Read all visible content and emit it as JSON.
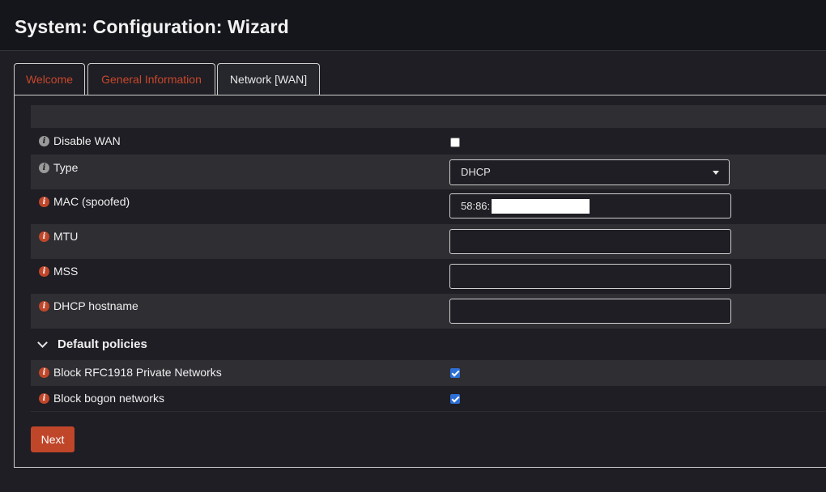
{
  "page": {
    "title": "System: Configuration: Wizard"
  },
  "tabs": [
    {
      "label": "Welcome",
      "active": false
    },
    {
      "label": "General Information",
      "active": false
    },
    {
      "label": "Network [WAN]",
      "active": true
    }
  ],
  "form": {
    "disable_wan": {
      "label": "Disable WAN",
      "checked": false
    },
    "type": {
      "label": "Type",
      "value": "DHCP"
    },
    "mac": {
      "label": "MAC (spoofed)",
      "value": "58:86:"
    },
    "mtu": {
      "label": "MTU",
      "value": ""
    },
    "mss": {
      "label": "MSS",
      "value": ""
    },
    "dhcp_hostname": {
      "label": "DHCP hostname",
      "value": ""
    },
    "section_default_policies": "Default policies",
    "block_rfc1918": {
      "label": "Block RFC1918 Private Networks",
      "checked": true
    },
    "block_bogon": {
      "label": "Block bogon networks",
      "checked": true
    }
  },
  "buttons": {
    "next": "Next"
  },
  "info_glyph": "i",
  "colors": {
    "accent": "#c0462a",
    "checkbox_checked": "#2d6fd6",
    "background": "#1e1e24",
    "row_alt": "#2e2e33"
  }
}
